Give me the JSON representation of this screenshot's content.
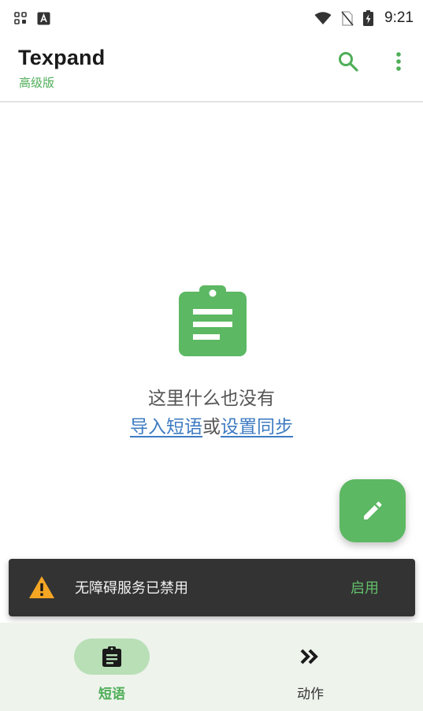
{
  "status_bar": {
    "time": "9:21"
  },
  "app_bar": {
    "title": "Texpand",
    "subtitle": "高级版",
    "icons": [
      "search-icon",
      "more-vertical-icon"
    ]
  },
  "empty_state": {
    "message": "这里什么也没有",
    "import_link": "导入短语",
    "separator": "或",
    "sync_link": "设置同步"
  },
  "fab": {
    "icon": "edit-icon"
  },
  "snackbar": {
    "message": "无障碍服务已禁用",
    "action": "启用",
    "icon": "warning-icon"
  },
  "bottom_nav": {
    "items": [
      {
        "label": "短语",
        "icon": "clipboard-icon",
        "selected": true
      },
      {
        "label": "动作",
        "icon": "double-chevron-right-icon",
        "selected": false
      }
    ]
  },
  "colors": {
    "accent": "#5cb863",
    "link": "#3d7bc2",
    "snackbar_bg": "#333333",
    "warning": "#f5a623",
    "nav_bg": "#eef3ec",
    "nav_pill": "#b9dfb7"
  }
}
